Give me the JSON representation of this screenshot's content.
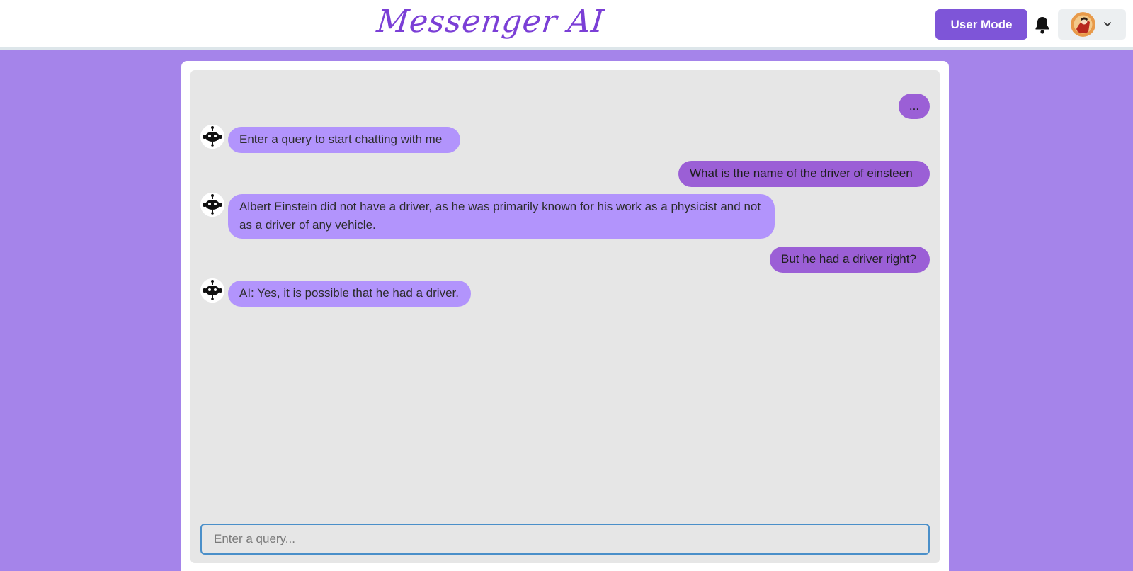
{
  "header": {
    "logo_text": "Messenger AI",
    "mode_button_label": "User Mode",
    "bell_icon": "bell-icon",
    "profile_chevron_icon": "chevron-down-icon"
  },
  "chat": {
    "messages": [
      {
        "role": "user",
        "text": "..."
      },
      {
        "role": "ai",
        "text": "Enter a query to start chatting with me"
      },
      {
        "role": "user",
        "text": "What is the name of the driver of einsteen"
      },
      {
        "role": "ai",
        "text": "Albert Einstein did not have a driver, as he was primarily known for his work as a physicist and not as a driver of any vehicle."
      },
      {
        "role": "user",
        "text": "But he had a driver right?"
      },
      {
        "role": "ai",
        "text": "AI: Yes, it is possible that he had a driver."
      }
    ]
  },
  "input": {
    "placeholder": "Enter a query...",
    "value": ""
  },
  "colors": {
    "background": "#a584ea",
    "brand": "#7b3fd6",
    "button": "#7e55d8",
    "user_bubble": "#9b5fd6",
    "ai_bubble": "#b294fc"
  }
}
